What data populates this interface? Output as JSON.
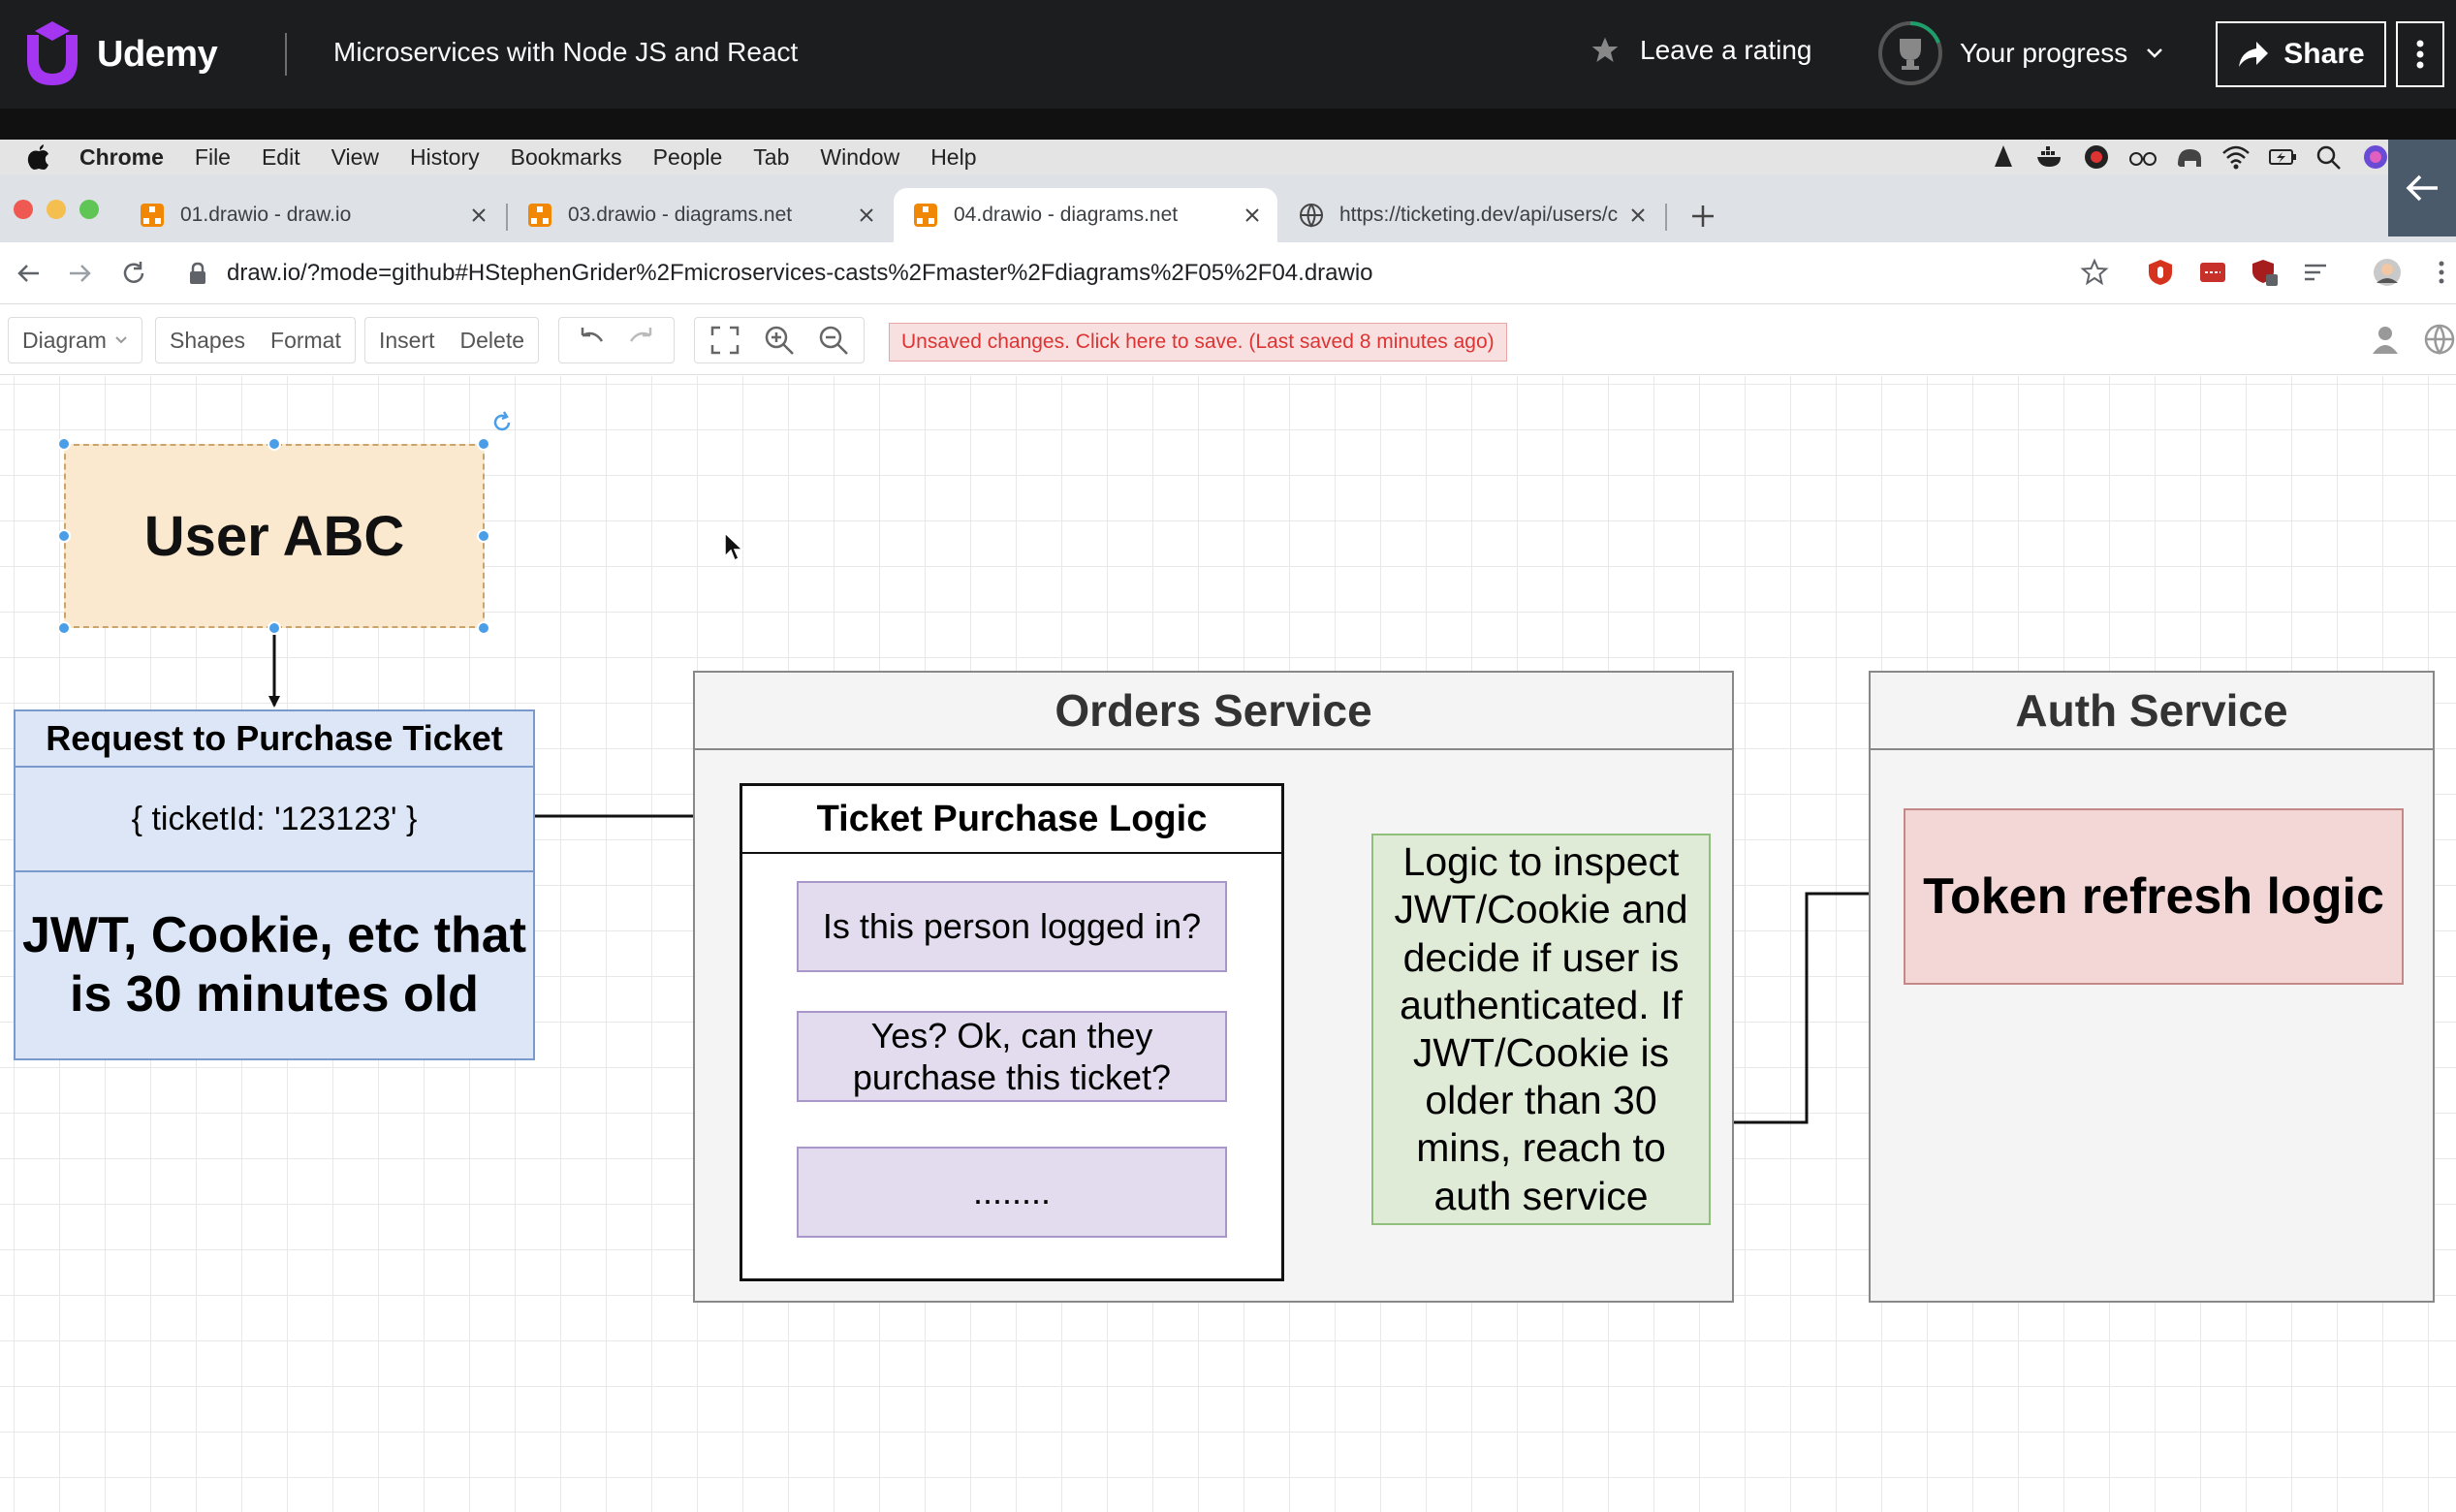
{
  "udemy": {
    "brand": "Udemy",
    "course_title": "Microservices with Node JS and React",
    "rating_label": "Leave a rating",
    "progress_label": "Your progress",
    "share_label": "Share"
  },
  "mac_menu": {
    "items": [
      "Chrome",
      "File",
      "Edit",
      "View",
      "History",
      "Bookmarks",
      "People",
      "Tab",
      "Window",
      "Help"
    ]
  },
  "tabs": [
    {
      "title": "01.drawio - draw.io",
      "active": false
    },
    {
      "title": "03.drawio - diagrams.net",
      "active": false
    },
    {
      "title": "04.drawio - diagrams.net",
      "active": true
    },
    {
      "title": "https://ticketing.dev/api/users/c",
      "active": false
    }
  ],
  "address_bar": {
    "url": "draw.io/?mode=github#HStephenGrider%2Fmicroservices-casts%2Fmaster%2Fdiagrams%2F05%2F04.drawio"
  },
  "drawio_toolbar": {
    "diagram_label": "Diagram",
    "shapes_label": "Shapes",
    "format_label": "Format",
    "insert_label": "Insert",
    "delete_label": "Delete",
    "unsaved_message": "Unsaved changes. Click here to save. (Last saved 8 minutes ago)"
  },
  "diagram": {
    "user": "User ABC",
    "request": {
      "title": "Request to Purchase Ticket",
      "payload": "{ ticketId: '123123' }",
      "jwt_line1": "JWT, Cookie, etc that",
      "jwt_line2": "is 30 minutes old"
    },
    "orders_service": {
      "title": "Orders Service",
      "logic_title": "Ticket Purchase Logic",
      "step1": "Is this person logged in?",
      "step2_line1": "Yes? Ok, can they",
      "step2_line2": "purchase this ticket?",
      "step3": "........",
      "inspect_lines": [
        "Logic to inspect",
        "JWT/Cookie and",
        "decide if user is",
        "authenticated.  If",
        "JWT/Cookie is",
        "older than 30",
        "mins, reach to",
        "auth service"
      ]
    },
    "auth_service": {
      "title": "Auth Service",
      "token_refresh": "Token refresh logic"
    }
  },
  "colors": {
    "udemy_bar": "#1c1d1f",
    "user_fill": "#fbe9cf",
    "request_fill": "#dde6f6",
    "step_fill": "#e3dcee",
    "inspect_fill": "#dfebd6",
    "token_fill": "#f3d6d6",
    "selection_handle": "#4a9ee8"
  }
}
